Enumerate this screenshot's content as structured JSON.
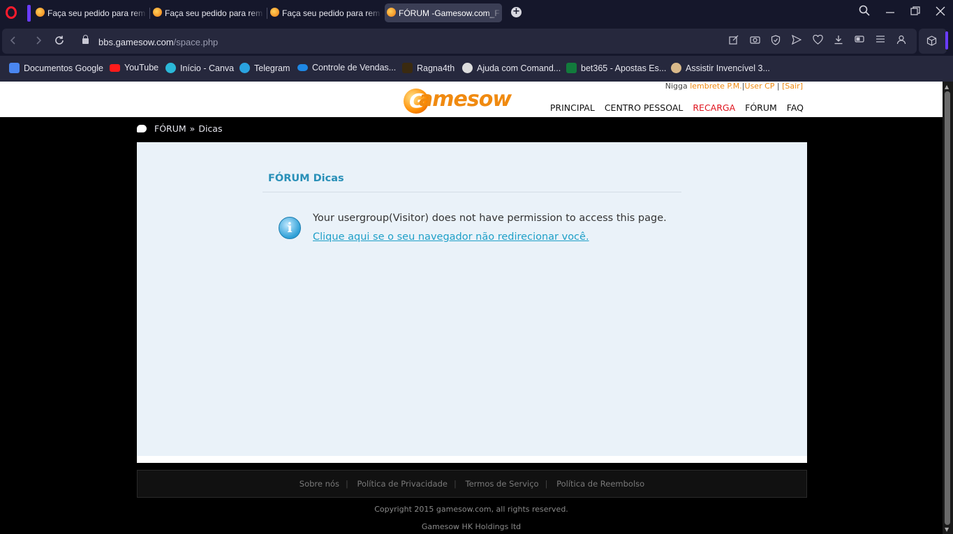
{
  "browser": {
    "tabs": [
      {
        "title": "Faça seu pedido para rem"
      },
      {
        "title": "Faça seu pedido para rem"
      },
      {
        "title": "Faça seu pedido para rem"
      },
      {
        "title": "FÓRUM -Gamesow.com_F"
      }
    ],
    "new_tab": "+",
    "url_host": "bbs.gamesow.com",
    "url_path": "/space.php",
    "bookmarks": [
      {
        "label": "Documentos Google"
      },
      {
        "label": "YouTube"
      },
      {
        "label": "Início - Canva"
      },
      {
        "label": "Telegram"
      },
      {
        "label": "Controle de Vendas..."
      },
      {
        "label": "Ragna4th"
      },
      {
        "label": "Ajuda com Comand..."
      },
      {
        "label": "bet365 - Apostas Es..."
      },
      {
        "label": "Assistir Invencível 3..."
      }
    ]
  },
  "header": {
    "logo_text": "amesow",
    "logo_letter": "G",
    "user_name": "Nigga",
    "reminder": "lembrete P.M.",
    "user_cp": "User CP",
    "logout": "[Sair]",
    "nav": [
      "PRINCIPAL",
      "CENTRO PESSOAL",
      "RECARGA",
      "FÓRUM",
      "FAQ"
    ]
  },
  "breadcrumb": {
    "root": "FÓRUM",
    "sep": "»",
    "current": "Dicas"
  },
  "main": {
    "title": "FÓRUM Dicas",
    "message": "Your usergroup(Visitor) does not have permission to access this page.",
    "redirect_link": "Clique aqui se o seu navegador não redirecionar você."
  },
  "footer": {
    "links": [
      "Sobre nós",
      "Política de Privacidade",
      "Termos de Serviço",
      "Política de Reembolso"
    ],
    "copyright": "Copyright 2015 gamesow.com, all rights reserved.",
    "company": "Gamesow HK Holdings ltd"
  }
}
